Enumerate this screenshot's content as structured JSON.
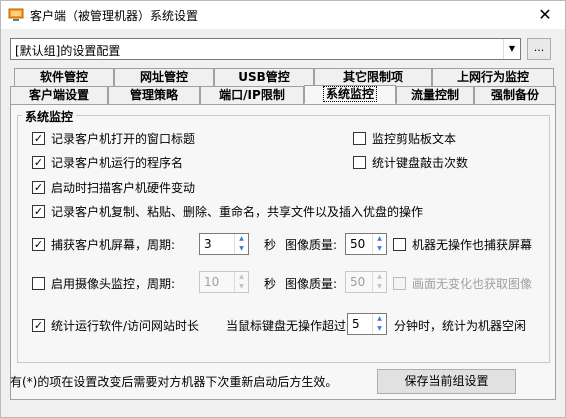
{
  "window": {
    "title": "客户端（被管理机器）系统设置",
    "close": "✕"
  },
  "config_combo": {
    "value": "[默认组]的设置配置",
    "dots": "..."
  },
  "tabs_row1": [
    {
      "label": "软件管控"
    },
    {
      "label": "网址管控"
    },
    {
      "label": "USB管控"
    },
    {
      "label": "其它限制项"
    },
    {
      "label": "上网行为监控"
    }
  ],
  "tabs_row2": [
    {
      "label": "客户端设置"
    },
    {
      "label": "管理策略"
    },
    {
      "label": "端口/IP限制"
    },
    {
      "label": "系统监控",
      "active": true
    },
    {
      "label": "流量控制"
    },
    {
      "label": "强制备份"
    }
  ],
  "group_title": "系统监控",
  "options": {
    "window_title": {
      "label": "记录客户机打开的窗口标题",
      "checked": true
    },
    "clipboard": {
      "label": "监控剪贴板文本",
      "checked": false
    },
    "program_name": {
      "label": "记录客户机运行的程序名",
      "checked": true
    },
    "keyboard_count": {
      "label": "统计键盘敲击次数",
      "checked": false
    },
    "hardware_scan": {
      "label": "启动时扫描客户机硬件变动",
      "checked": true
    },
    "file_ops": {
      "label": "记录客户机复制、粘贴、删除、重命名，共享文件以及插入优盘的操作",
      "checked": true
    }
  },
  "screen_capture": {
    "label": "捕获客户机屏幕，周期:",
    "checked": true,
    "period": "3",
    "unit": "秒",
    "quality_label": "图像质量:",
    "quality": "50",
    "idle_label": "机器无操作也捕获屏幕",
    "idle_checked": false
  },
  "camera": {
    "label": "启用摄像头监控，周期:",
    "checked": false,
    "period": "10",
    "unit": "秒",
    "quality_label": "图像质量:",
    "quality": "50",
    "nochange_label": "画面无变化也获取图像",
    "nochange_checked": false
  },
  "stats": {
    "label": "统计运行软件/访问网站时长",
    "checked": true,
    "idle_prefix": "当鼠标键盘无操作超过",
    "idle_minutes": "5",
    "idle_suffix": "分钟时，统计为机器空闲"
  },
  "footer": {
    "note": "有(*)的项在设置改变后需要对方机器下次重新启动后方生效。",
    "save_label": "保存当前组设置"
  },
  "glyphs": {
    "check": "✓",
    "up": "▲",
    "down": "▼",
    "dropdown": "▼"
  },
  "colors": {
    "accent": "#3a7bd5",
    "panel": "#f7f7f7",
    "window": "#f0f0f0"
  }
}
